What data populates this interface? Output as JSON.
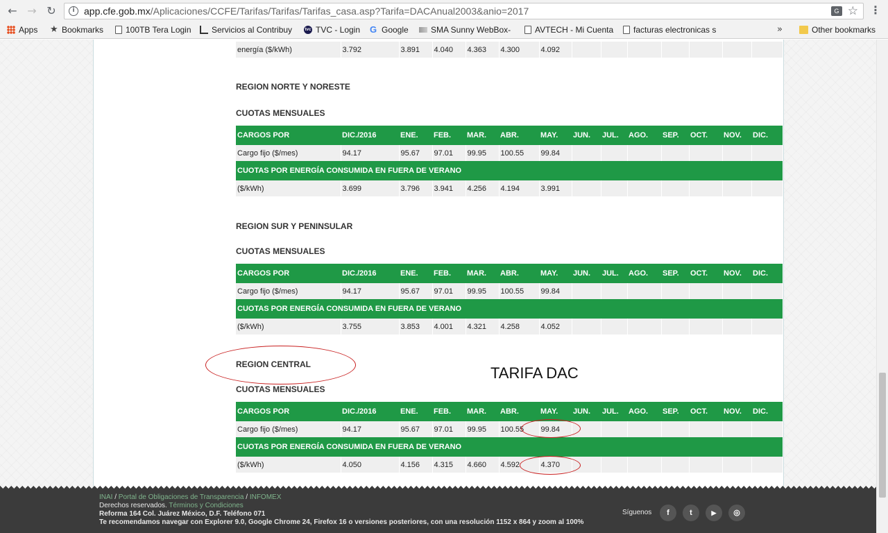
{
  "browser": {
    "url_host": "app.cfe.gob.mx",
    "url_path": "/Aplicaciones/CCFE/Tarifas/Tarifas/Tarifas_casa.asp?Tarifa=DACAnual2003&anio=2017",
    "bookmarks": [
      "Apps",
      "Bookmarks",
      "100TB Tera Login",
      "Servicios al Contribuy",
      "TVC - Login",
      "Google",
      "SMA Sunny WebBox-",
      "AVTECH - Mi Cuenta",
      "facturas electronicas s"
    ],
    "more": "»",
    "other_bookmarks": "Other bookmarks"
  },
  "headers": [
    "CARGOS POR",
    "DIC./2016",
    "ENE.",
    "FEB.",
    "MAR.",
    "ABR.",
    "MAY.",
    "JUN.",
    "JUL.",
    "AGO.",
    "SEP.",
    "OCT.",
    "NOV.",
    "DIC."
  ],
  "sub_header": "CUOTAS POR ENERGÍA CONSUMIDA EN FUERA DE VERANO",
  "top_row": {
    "label": "energía ($/kWh)",
    "values": [
      "3.792",
      "3.891",
      "4.040",
      "4.363",
      "4.300",
      "4.092"
    ]
  },
  "regions": [
    {
      "title": "REGION NORTE Y NORESTE",
      "subtitle": "CUOTAS MENSUALES",
      "fixed": {
        "label": "Cargo fijo ($/mes)",
        "values": [
          "94.17",
          "95.67",
          "97.01",
          "99.95",
          "100.55",
          "99.84"
        ]
      },
      "energy": {
        "label": "($/kWh)",
        "values": [
          "3.699",
          "3.796",
          "3.941",
          "4.256",
          "4.194",
          "3.991"
        ]
      }
    },
    {
      "title": "REGION SUR Y PENINSULAR",
      "subtitle": "CUOTAS MENSUALES",
      "fixed": {
        "label": "Cargo fijo ($/mes)",
        "values": [
          "94.17",
          "95.67",
          "97.01",
          "99.95",
          "100.55",
          "99.84"
        ]
      },
      "energy": {
        "label": "($/kWh)",
        "values": [
          "3.755",
          "3.853",
          "4.001",
          "4.321",
          "4.258",
          "4.052"
        ]
      }
    },
    {
      "title": "REGION CENTRAL",
      "subtitle": "CUOTAS MENSUALES",
      "fixed": {
        "label": "Cargo fijo ($/mes)",
        "values": [
          "94.17",
          "95.67",
          "97.01",
          "99.95",
          "100.55",
          "99.84"
        ]
      },
      "energy": {
        "label": "($/kWh)",
        "values": [
          "4.050",
          "4.156",
          "4.315",
          "4.660",
          "4.592",
          "4.370"
        ]
      }
    }
  ],
  "annotation": "TARIFA DAC",
  "footer": {
    "inai": "INAI",
    "sep1": " / ",
    "portal": "Portal de Obligaciones de Transparencia",
    "sep2": " / ",
    "infomex": "INFOMEX",
    "rights": "Derechos reservados. ",
    "terms": "Términos y Condiciones",
    "address": "Reforma 164 Col. Juárez México, D.F. Teléfono 071",
    "browser_note": "Te recomendamos navegar con Explorer 9.0, Google Chrome 24, Firefox 16 o versiones posteriores, con una resolución 1152 x 864 y zoom al 100%",
    "follow": "Síguenos",
    "social": [
      "f",
      "t",
      "▶",
      "◎"
    ]
  }
}
